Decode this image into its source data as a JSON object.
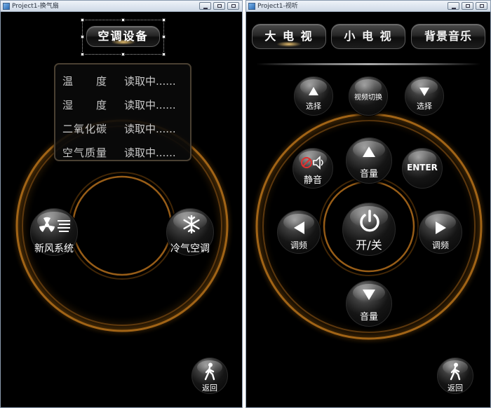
{
  "colors": {
    "background": "#000000",
    "ring_gold": "#c07a18",
    "text": "#ffffff",
    "info_text": "#c9c9c9",
    "titlebar": "#dbe4ef"
  },
  "left_window": {
    "title": "Project1-换气扇",
    "device_button": "空调设备",
    "info": [
      {
        "label": "温　　度",
        "value": "读取中......"
      },
      {
        "label": "湿　　度",
        "value": "读取中......"
      },
      {
        "label": "二氧化碳",
        "value": "读取中......"
      },
      {
        "label": "空气质量",
        "value": "读取中......"
      }
    ],
    "fresh_air_button": {
      "label": "新风系统",
      "icon": "fan-icon"
    },
    "cold_air_button": {
      "label": "冷气空调",
      "icon": "snowflake-icon"
    },
    "back_button": {
      "label": "返回",
      "icon": "walking-person-icon"
    }
  },
  "right_window": {
    "title": "Project1-视听",
    "tabs": [
      {
        "label": "大 电 视",
        "active": true
      },
      {
        "label": "小 电 视",
        "active": false
      },
      {
        "label": "背景音乐",
        "active": false
      }
    ],
    "select_up": {
      "label": "选择",
      "icon": "arrow-up-icon"
    },
    "video_switch": {
      "label": "视频切换"
    },
    "select_down": {
      "label": "选择",
      "icon": "arrow-down-icon"
    },
    "mute": {
      "label": "静音",
      "icon": "mute-icon"
    },
    "volume_up": {
      "label": "音量",
      "icon": "arrow-up-icon"
    },
    "enter": {
      "label": "ENTER"
    },
    "tune_left": {
      "label": "调频",
      "icon": "arrow-left-icon"
    },
    "power": {
      "label": "开/关",
      "icon": "power-icon"
    },
    "tune_right": {
      "label": "调频",
      "icon": "arrow-right-icon"
    },
    "volume_down": {
      "label": "音量",
      "icon": "arrow-down-icon"
    },
    "back_button": {
      "label": "返回",
      "icon": "walking-person-icon"
    }
  }
}
